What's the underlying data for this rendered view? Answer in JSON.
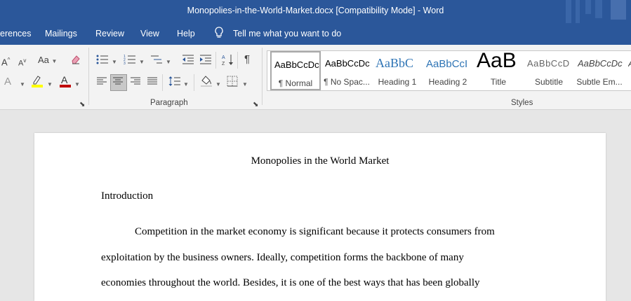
{
  "window": {
    "title": "Monopolies-in-the-World-Market.docx [Compatibility Mode]  -  Word"
  },
  "tabs": [
    {
      "label": "erences"
    },
    {
      "label": "Mailings"
    },
    {
      "label": "Review"
    },
    {
      "label": "View"
    },
    {
      "label": "Help"
    }
  ],
  "tell_me": "Tell me what you want to do",
  "ribbon": {
    "font_case_label": "Aa",
    "grow_font": "A",
    "shrink_font": "A",
    "paragraph_label": "Paragraph",
    "styles_label": "Styles",
    "styles": [
      {
        "sample": "AaBbCcDc",
        "name": "¶ Normal"
      },
      {
        "sample": "AaBbCcDc",
        "name": "¶ No Spac..."
      },
      {
        "sample": "AaBbC",
        "name": "Heading 1"
      },
      {
        "sample": "AaBbCcI",
        "name": "Heading 2"
      },
      {
        "sample": "AaB",
        "name": "Title"
      },
      {
        "sample": "AaBbCcD",
        "name": "Subtitle"
      },
      {
        "sample": "AaBbCcDc",
        "name": "Subtle Em..."
      },
      {
        "sample": "A",
        "name": ""
      }
    ]
  },
  "document": {
    "title": "Monopolies in the World Market",
    "heading": "Introduction",
    "lines": [
      "Competition in the market economy is significant because it protects consumers from",
      "exploitation by the business owners. Ideally, competition forms the backbone of many",
      "economies throughout the world. Besides, it is one of the best ways that has been globally"
    ]
  },
  "colors": {
    "title_bar": "#2b579a",
    "highlight": "#ffff00",
    "font_color": "#c00000"
  }
}
